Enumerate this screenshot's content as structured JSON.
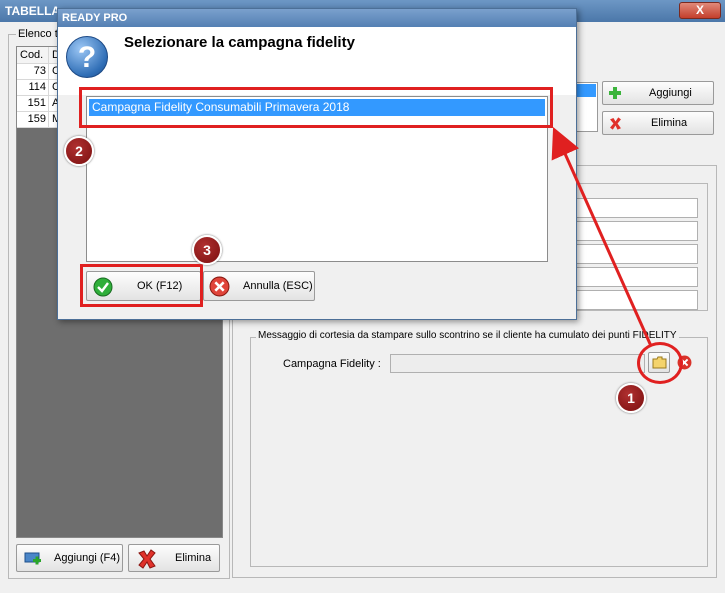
{
  "main_window": {
    "title": "TABELLA",
    "close_label": "X",
    "list_group_label": "Elenco t",
    "table": {
      "headers": [
        "Cod.",
        "D"
      ],
      "rows": [
        {
          "code": "73",
          "desc": "C"
        },
        {
          "code": "114",
          "desc": "C"
        },
        {
          "code": "151",
          "desc": "A"
        },
        {
          "code": "159",
          "desc": "M"
        }
      ]
    },
    "add_button_label": "Aggiungi (F4)",
    "delete_button_label": "Elimina",
    "right_add_label": "Aggiungi",
    "right_delete_label": "Elimina",
    "fidelity_group_label": "Messaggio di cortesia da stampare sullo scontrino se il cliente ha cumulato dei punti FIDELITY",
    "campaign_label": "Campagna Fidelity :",
    "campaign_value": ""
  },
  "dialog": {
    "title": "READY PRO",
    "heading": "Selezionare la campagna fidelity",
    "items": [
      "Campagna Fidelity Consumabili Primavera 2018"
    ],
    "ok_label": "OK (F12)",
    "cancel_label": "Annulla (ESC)"
  },
  "annotations": [
    "1",
    "2",
    "3"
  ],
  "colors": {
    "highlight": "#e02020",
    "selection": "#3399ff",
    "title_bar": "#5480b3"
  }
}
